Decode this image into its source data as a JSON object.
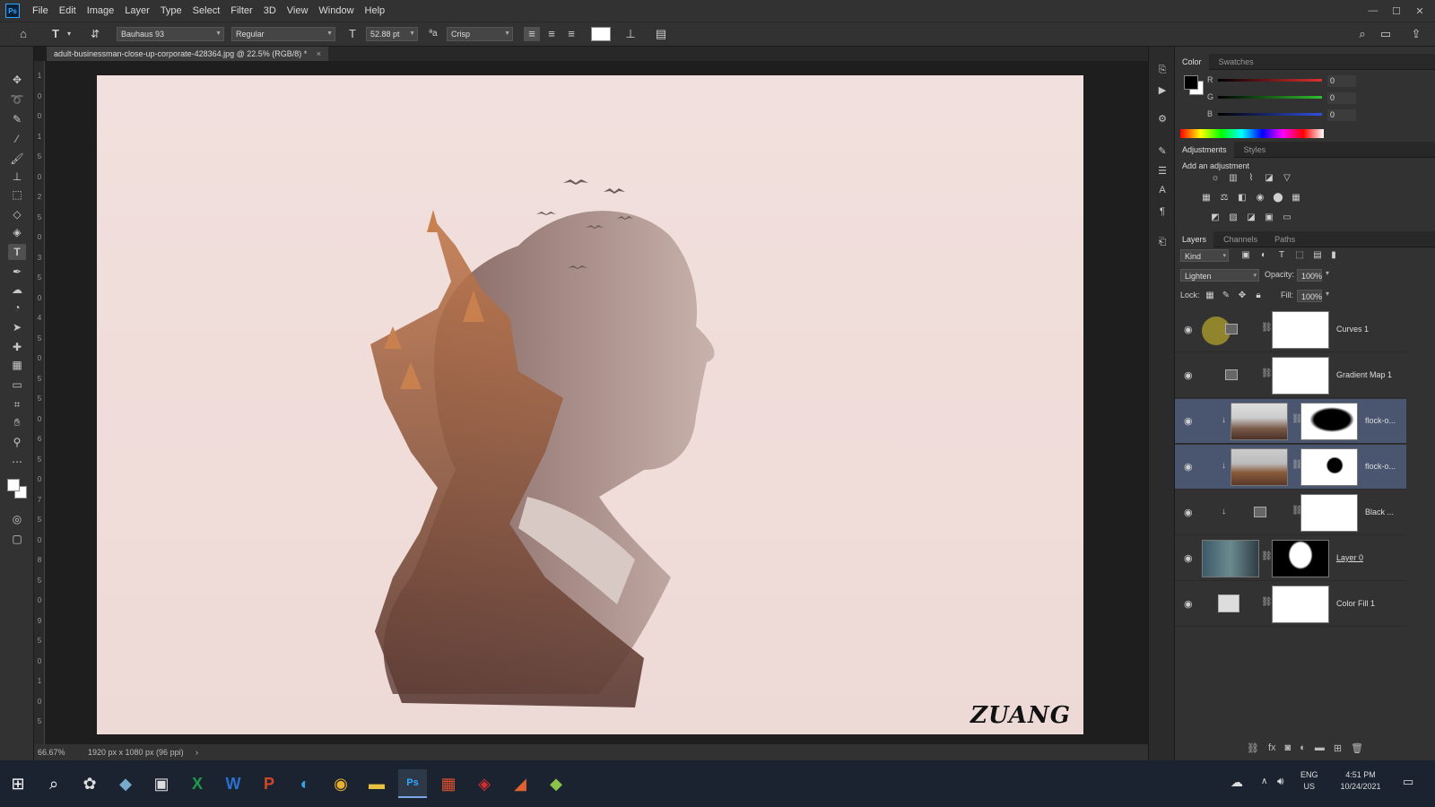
{
  "app": {
    "logo_text": "Ps"
  },
  "menu": [
    "File",
    "Edit",
    "Image",
    "Layer",
    "Type",
    "Select",
    "Filter",
    "3D",
    "View",
    "Window",
    "Help"
  ],
  "options_bar": {
    "font_family": "Bauhaus 93",
    "font_style": "Regular",
    "font_size": "52.88 pt",
    "anti_alias": "Crisp",
    "text_color": "#ffffff"
  },
  "document": {
    "tab_title": "adult-businessman-close-up-corporate-428364.jpg @ 22.5% (RGB/8) *",
    "signature_text": "ZUANG",
    "canvas_color": "#f0dcd9"
  },
  "ruler_labels": [
    "1",
    "0",
    "0",
    "1",
    "5",
    "0",
    "2",
    "5",
    "0",
    "3",
    "5",
    "0",
    "4",
    "5",
    "0",
    "5",
    "5",
    "0",
    "6",
    "5",
    "0",
    "7",
    "5",
    "0",
    "8",
    "5",
    "0",
    "9",
    "5",
    "0",
    "1",
    "0",
    "5"
  ],
  "status": {
    "zoom": "66.67%",
    "doc_info": "1920 px x 1080 px (96 ppi)"
  },
  "color_panel": {
    "tabs": [
      "Color",
      "Swatches"
    ],
    "channels": [
      {
        "label": "R",
        "value": "0",
        "color": "#e03030"
      },
      {
        "label": "G",
        "value": "0",
        "color": "#30c030"
      },
      {
        "label": "B",
        "value": "0",
        "color": "#3050e0"
      }
    ]
  },
  "adjustments_panel": {
    "tabs": [
      "Adjustments",
      "Styles"
    ],
    "heading": "Add an adjustment"
  },
  "layers_panel": {
    "tabs": [
      "Layers",
      "Channels",
      "Paths"
    ],
    "filter_kind": "Kind",
    "blend_mode": "Lighten",
    "opacity_label": "Opacity:",
    "opacity": "100%",
    "lock_label": "Lock:",
    "fill_label": "Fill:",
    "fill": "100%",
    "layers": [
      {
        "name": "Curves 1",
        "kind": "adjustment",
        "selected": false,
        "clipped": false
      },
      {
        "name": "Gradient Map 1",
        "kind": "adjustment",
        "selected": false,
        "clipped": false
      },
      {
        "name": "flock-o...",
        "kind": "image",
        "selected": true,
        "clipped": true
      },
      {
        "name": "flock-o...",
        "kind": "image",
        "selected": true,
        "clipped": true
      },
      {
        "name": "Black ...",
        "kind": "adjustment",
        "selected": false,
        "clipped": true
      },
      {
        "name": "Layer 0",
        "kind": "image",
        "selected": false,
        "clipped": false
      },
      {
        "name": "Color Fill 1",
        "kind": "fill",
        "selected": false,
        "clipped": false
      }
    ]
  },
  "taskbar": {
    "lang": "ENG",
    "region": "US",
    "time": "4:51 PM",
    "date": "10/24/2021"
  }
}
